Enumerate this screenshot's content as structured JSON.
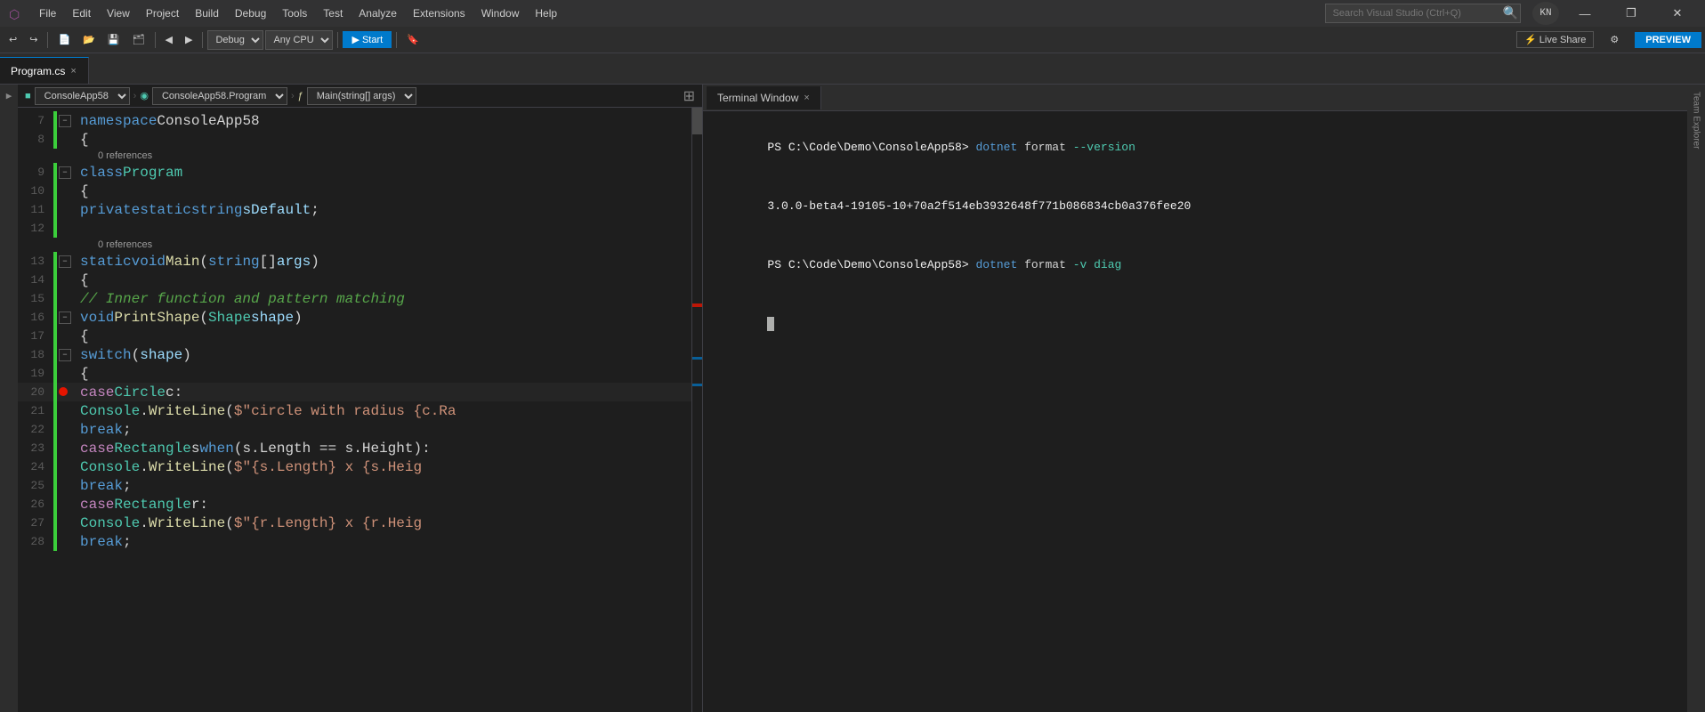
{
  "titlebar": {
    "menu_items": [
      "File",
      "Edit",
      "View",
      "Project",
      "Build",
      "Debug",
      "Tools",
      "Test",
      "Analyze",
      "Extensions",
      "Window",
      "Help"
    ],
    "search_placeholder": "Search Visual Studio (Ctrl+Q)",
    "minimize": "—",
    "restore": "❐",
    "close": "✕",
    "profile": "KN"
  },
  "toolbar": {
    "back": "◀",
    "forward": "▶",
    "debug_config": "Debug",
    "cpu_config": "Any CPU",
    "start_label": "▶ Start",
    "live_share": "⚡ Live Share",
    "preview": "PREVIEW"
  },
  "tabs": [
    {
      "label": "Program.cs",
      "active": true,
      "closeable": true
    },
    {
      "label": "×",
      "active": false,
      "closeable": false
    }
  ],
  "breadcrumb": {
    "project": "ConsoleApp58",
    "class": "ConsoleApp58.Program",
    "method": "Main(string[] args)"
  },
  "code": {
    "lines": [
      {
        "num": 7,
        "content": "namespace ConsoleApp58",
        "tokens": [
          {
            "t": "kw",
            "v": "namespace"
          },
          {
            "t": "plain",
            "v": " ConsoleApp58"
          }
        ]
      },
      {
        "num": 8,
        "content": "    {",
        "tokens": [
          {
            "t": "plain",
            "v": "    {"
          }
        ]
      },
      {
        "num": 9,
        "content": "        0 references\n        class Program",
        "ref": "0 references",
        "tokens": [
          {
            "t": "kw",
            "v": "        class"
          },
          {
            "t": "ns",
            "v": " Program"
          }
        ]
      },
      {
        "num": 10,
        "content": "        {",
        "tokens": [
          {
            "t": "plain",
            "v": "        {"
          }
        ]
      },
      {
        "num": 11,
        "content": "        private static string sDefault;",
        "tokens": [
          {
            "t": "kw",
            "v": "        private"
          },
          {
            "t": "plain",
            "v": " "
          },
          {
            "t": "kw",
            "v": "static"
          },
          {
            "t": "plain",
            "v": " "
          },
          {
            "t": "kw",
            "v": "string"
          },
          {
            "t": "plain",
            "v": " "
          },
          {
            "t": "var",
            "v": "sDefault"
          },
          {
            "t": "plain",
            "v": ";"
          }
        ]
      },
      {
        "num": 12,
        "content": "",
        "tokens": []
      },
      {
        "num": 13,
        "content": "        0 references\n        static void Main(string[] args)",
        "ref": "0 references",
        "tokens": [
          {
            "t": "kw",
            "v": "        static"
          },
          {
            "t": "plain",
            "v": " "
          },
          {
            "t": "kw",
            "v": "void"
          },
          {
            "t": "plain",
            "v": " "
          },
          {
            "t": "method",
            "v": "Main"
          },
          {
            "t": "plain",
            "v": "("
          },
          {
            "t": "kw",
            "v": "string"
          },
          {
            "t": "plain",
            "v": "[] "
          },
          {
            "t": "var",
            "v": "args"
          },
          {
            "t": "plain",
            "v": ")"
          }
        ]
      },
      {
        "num": 14,
        "content": "        {",
        "tokens": [
          {
            "t": "plain",
            "v": "        {"
          }
        ]
      },
      {
        "num": 15,
        "content": "            // Inner function and pattern matching",
        "tokens": [
          {
            "t": "comment",
            "v": "            // Inner function and pattern matching"
          }
        ]
      },
      {
        "num": 16,
        "content": "            void PrintShape(Shape shape)",
        "tokens": [
          {
            "t": "kw",
            "v": "            void"
          },
          {
            "t": "plain",
            "v": " "
          },
          {
            "t": "method",
            "v": "PrintShape"
          },
          {
            "t": "plain",
            "v": "("
          },
          {
            "t": "kw3",
            "v": "Shape"
          },
          {
            "t": "plain",
            "v": " "
          },
          {
            "t": "var",
            "v": "shape"
          },
          {
            "t": "plain",
            "v": ")"
          }
        ]
      },
      {
        "num": 17,
        "content": "            {",
        "tokens": [
          {
            "t": "plain",
            "v": "            {"
          }
        ]
      },
      {
        "num": 18,
        "content": "                switch (shape)",
        "tokens": [
          {
            "t": "kw",
            "v": "                switch"
          },
          {
            "t": "plain",
            "v": " ("
          },
          {
            "t": "var",
            "v": "shape"
          },
          {
            "t": "plain",
            "v": ")"
          }
        ]
      },
      {
        "num": 19,
        "content": "                {",
        "tokens": [
          {
            "t": "plain",
            "v": "                {"
          }
        ]
      },
      {
        "num": 20,
        "content": "            case Circle c:",
        "tokens": [
          {
            "t": "kw2",
            "v": "            case"
          },
          {
            "t": "plain",
            "v": " "
          },
          {
            "t": "kw3",
            "v": "Circle"
          },
          {
            "t": "plain",
            "v": " c:"
          }
        ]
      },
      {
        "num": 21,
        "content": "                    Console.WriteLine($\"circle with radius {c.Ra",
        "tokens": [
          {
            "t": "ns",
            "v": "                    Console"
          },
          {
            "t": "plain",
            "v": "."
          },
          {
            "t": "method",
            "v": "WriteLine"
          },
          {
            "t": "plain",
            "v": "("
          },
          {
            "t": "str",
            "v": "$\"circle with radius {c.Ra"
          }
        ]
      },
      {
        "num": 22,
        "content": "                break;",
        "tokens": [
          {
            "t": "kw",
            "v": "                break"
          },
          {
            "t": "plain",
            "v": ";"
          }
        ]
      },
      {
        "num": 23,
        "content": "            case Rectangle s when (s.Length == s.Height):",
        "tokens": [
          {
            "t": "kw2",
            "v": "            case"
          },
          {
            "t": "plain",
            "v": " "
          },
          {
            "t": "kw3",
            "v": "Rectangle"
          },
          {
            "t": "plain",
            "v": " s "
          },
          {
            "t": "kw",
            "v": "when"
          },
          {
            "t": "plain",
            "v": " ("
          },
          {
            "t": "var",
            "v": "s"
          },
          {
            "t": "plain",
            "v": ".Length == "
          },
          {
            "t": "var",
            "v": "s"
          },
          {
            "t": "plain",
            "v": ".Height):"
          }
        ]
      },
      {
        "num": 24,
        "content": "                    Console.WriteLine($\"{s.Length} x {s.Heig",
        "tokens": [
          {
            "t": "ns",
            "v": "                    Console"
          },
          {
            "t": "plain",
            "v": "."
          },
          {
            "t": "method",
            "v": "WriteLine"
          },
          {
            "t": "plain",
            "v": "("
          },
          {
            "t": "str",
            "v": "$\"{s.Length} x {s.Heig"
          }
        ]
      },
      {
        "num": 25,
        "content": "                    break;",
        "tokens": [
          {
            "t": "kw",
            "v": "                    break"
          },
          {
            "t": "plain",
            "v": ";"
          }
        ]
      },
      {
        "num": 26,
        "content": "                case Rectangle r:",
        "tokens": [
          {
            "t": "kw2",
            "v": "                case"
          },
          {
            "t": "plain",
            "v": " "
          },
          {
            "t": "kw3",
            "v": "Rectangle"
          },
          {
            "t": "plain",
            "v": " r:"
          }
        ]
      },
      {
        "num": 27,
        "content": "                    Console.WriteLine($\"{r.Length} x {r.Heig",
        "tokens": [
          {
            "t": "ns",
            "v": "                    Console"
          },
          {
            "t": "plain",
            "v": "."
          },
          {
            "t": "method",
            "v": "WriteLine"
          },
          {
            "t": "plain",
            "v": "("
          },
          {
            "t": "str",
            "v": "$\"{r.Length} x {r.Heig"
          }
        ]
      },
      {
        "num": 28,
        "content": "                    break;",
        "tokens": [
          {
            "t": "kw",
            "v": "                    break"
          },
          {
            "t": "plain",
            "v": ";"
          }
        ]
      }
    ]
  },
  "terminal": {
    "tab_label": "Terminal Window",
    "close": "×",
    "lines": [
      {
        "ps": "PS",
        "path": "C:\\Code\\Demo\\ConsoleApp58>",
        "cmd": "dotnet",
        "args": " format ",
        "flag": "--version"
      },
      {
        "output": "3.0.0-beta4-19105-10+70a2f514eb3932648f771b086834cb0a376fee20"
      },
      {
        "ps": "PS",
        "path": "C:\\Code\\Demo\\ConsoleApp58>",
        "cmd": "dotnet",
        "args": " format ",
        "flag": "-v diag"
      }
    ]
  },
  "right_sidebar": {
    "label": "Team Explorer"
  },
  "colors": {
    "accent": "#007acc",
    "bg_dark": "#1e1e1e",
    "bg_mid": "#2d2d2d",
    "tab_active_border": "#007acc"
  }
}
